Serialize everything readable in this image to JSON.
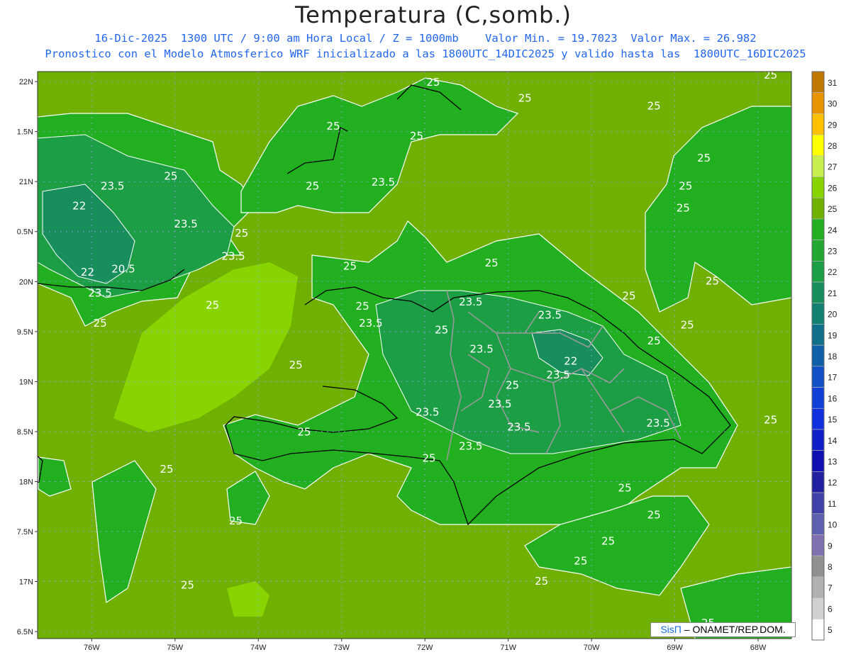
{
  "header": {
    "title": "Temperatura (C,somb.)",
    "line1": "16-Dic-2025  1300 UTC / 9:00 am Hora Local / Z = 1000mb    Valor Min. = 19.7023  Valor Max. = 26.982",
    "line2": "Pronostico con el Modelo Atmosferico WRF inicializado a las 1800UTC_14DIC2025 y valido hasta las  1800UTC_16DIC2025"
  },
  "map": {
    "variable": "Temperatura",
    "units": "C",
    "level_mb": 1000,
    "valid_date": "16-Dic-2025",
    "valid_time_utc": "1300 UTC",
    "local_time": "9:00 am",
    "min_value": 19.7023,
    "max_value": 26.982,
    "lat_range": [
      16.43,
      22.1
    ],
    "lon_range": [
      -76.65,
      -67.6
    ],
    "lat_ticks": [
      "22N",
      "1.5N",
      "21N",
      "0.5N",
      "20N",
      "9.5N",
      "19N",
      "8.5N",
      "18N",
      "7.5N",
      "17N",
      "6.5N"
    ],
    "lon_ticks": [
      "76W",
      "75W",
      "74W",
      "73W",
      "72W",
      "71W",
      "70W",
      "69W",
      "68W"
    ],
    "contour_labels": [
      {
        "text": "25",
        "lon": -72.9,
        "lat": 20.12
      },
      {
        "text": "25",
        "lon": -71.2,
        "lat": 20.15
      },
      {
        "text": "25",
        "lon": -75.9,
        "lat": 19.55
      },
      {
        "text": "25",
        "lon": -73.55,
        "lat": 19.13
      },
      {
        "text": "25",
        "lon": -72.75,
        "lat": 19.72
      },
      {
        "text": "25",
        "lon": -73.45,
        "lat": 18.46
      },
      {
        "text": "25",
        "lon": -71.95,
        "lat": 18.2
      },
      {
        "text": "25",
        "lon": -71.8,
        "lat": 19.48
      },
      {
        "text": "25",
        "lon": -70.95,
        "lat": 18.93
      },
      {
        "text": "25",
        "lon": -69.25,
        "lat": 19.37
      },
      {
        "text": "25",
        "lon": -68.85,
        "lat": 19.53
      },
      {
        "text": "25",
        "lon": -69.55,
        "lat": 19.82
      },
      {
        "text": "25",
        "lon": -68.55,
        "lat": 19.97
      },
      {
        "text": "25",
        "lon": -75.1,
        "lat": 18.09
      },
      {
        "text": "25",
        "lon": -74.55,
        "lat": 19.73
      },
      {
        "text": "25",
        "lon": -75.05,
        "lat": 21.02
      },
      {
        "text": "25",
        "lon": -74.2,
        "lat": 20.45
      },
      {
        "text": "25",
        "lon": -73.35,
        "lat": 20.92
      },
      {
        "text": "25",
        "lon": -73.1,
        "lat": 21.52
      },
      {
        "text": "25",
        "lon": -72.1,
        "lat": 21.42
      },
      {
        "text": "25",
        "lon": -70.8,
        "lat": 21.8
      },
      {
        "text": "25",
        "lon": -71.9,
        "lat": 21.96
      },
      {
        "text": "25",
        "lon": -69.25,
        "lat": 21.72
      },
      {
        "text": "25",
        "lon": -68.65,
        "lat": 21.2
      },
      {
        "text": "25",
        "lon": -68.87,
        "lat": 20.92
      },
      {
        "text": "25",
        "lon": -68.9,
        "lat": 20.7
      },
      {
        "text": "25",
        "lon": -67.85,
        "lat": 22.03
      },
      {
        "text": "25",
        "lon": -67.85,
        "lat": 18.58
      },
      {
        "text": "25",
        "lon": -69.6,
        "lat": 17.9
      },
      {
        "text": "25",
        "lon": -69.25,
        "lat": 17.63
      },
      {
        "text": "25",
        "lon": -69.8,
        "lat": 17.37
      },
      {
        "text": "25",
        "lon": -70.13,
        "lat": 17.17
      },
      {
        "text": "25",
        "lon": -70.6,
        "lat": 16.97
      },
      {
        "text": "25",
        "lon": -74.27,
        "lat": 17.57
      },
      {
        "text": "25",
        "lon": -74.85,
        "lat": 16.93
      },
      {
        "text": "25",
        "lon": -68.6,
        "lat": 16.55
      },
      {
        "text": "23.5",
        "lon": -75.75,
        "lat": 20.92
      },
      {
        "text": "23.5",
        "lon": -74.87,
        "lat": 20.54
      },
      {
        "text": "23.5",
        "lon": -74.3,
        "lat": 20.22
      },
      {
        "text": "23.5",
        "lon": -75.9,
        "lat": 19.85
      },
      {
        "text": "23.5",
        "lon": -72.65,
        "lat": 19.55
      },
      {
        "text": "23.5",
        "lon": -71.45,
        "lat": 19.76
      },
      {
        "text": "23.5",
        "lon": -70.5,
        "lat": 19.63
      },
      {
        "text": "23.5",
        "lon": -72.5,
        "lat": 20.96
      },
      {
        "text": "23.5",
        "lon": -71.32,
        "lat": 19.29
      },
      {
        "text": "23.5",
        "lon": -70.4,
        "lat": 19.03
      },
      {
        "text": "23.5",
        "lon": -71.1,
        "lat": 18.74
      },
      {
        "text": "23.5",
        "lon": -71.97,
        "lat": 18.66
      },
      {
        "text": "23.5",
        "lon": -70.87,
        "lat": 18.51
      },
      {
        "text": "23.5",
        "lon": -71.45,
        "lat": 18.32
      },
      {
        "text": "23.5",
        "lon": -69.2,
        "lat": 18.55
      },
      {
        "text": "22",
        "lon": -70.25,
        "lat": 19.17
      },
      {
        "text": "22",
        "lon": -76.15,
        "lat": 20.72
      },
      {
        "text": "22",
        "lon": -76.05,
        "lat": 20.06
      },
      {
        "text": "20.5",
        "lon": -75.62,
        "lat": 20.09
      }
    ]
  },
  "colorbar": {
    "levels": [
      "31",
      "30",
      "29",
      "28",
      "27",
      "26",
      "25",
      "24",
      "23",
      "22",
      "21",
      "20",
      "19",
      "18",
      "17",
      "16",
      "15",
      "14",
      "13",
      "12",
      "11",
      "10",
      "9",
      "8",
      "7",
      "6",
      "5"
    ],
    "colors": [
      "#c07800",
      "#e89400",
      "#ffc000",
      "#ffff00",
      "#c8ee50",
      "#88d400",
      "#70b000",
      "#22b020",
      "#22a830",
      "#1c9e44",
      "#178e5c",
      "#138074",
      "#10708a",
      "#1060a8",
      "#1050c4",
      "#1040d8",
      "#1030e0",
      "#1020c8",
      "#1010b0",
      "#2020a0",
      "#4040a8",
      "#6060b0",
      "#8070b0",
      "#909090",
      "#b0b0b0",
      "#d0d0d0",
      "#ffffff"
    ]
  },
  "credit": {
    "logo": "SisΠ",
    "text": "ONAMET/REP.DOM."
  }
}
